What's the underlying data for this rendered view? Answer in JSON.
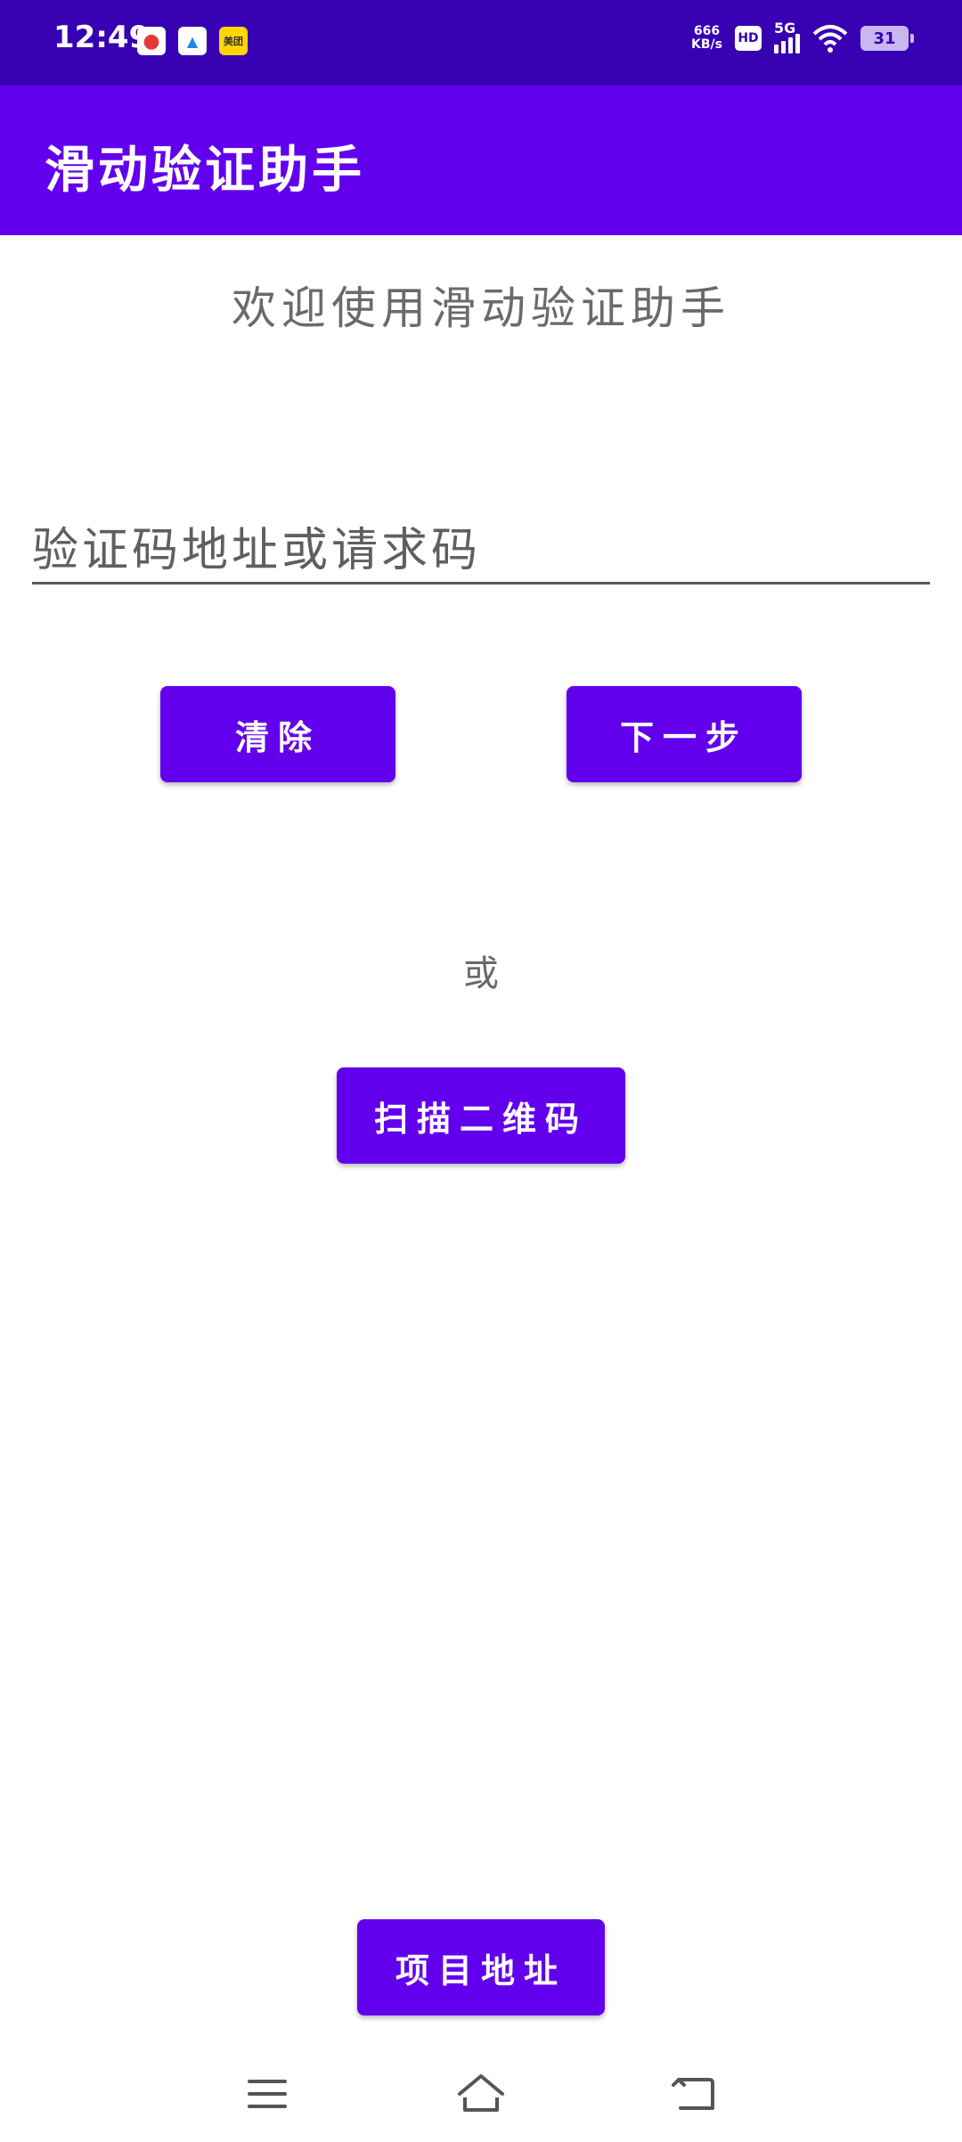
{
  "status_bar": {
    "time": "12:49",
    "notifications": [
      "map-pin-icon",
      "game-icon",
      "meituan-icon"
    ],
    "meituan_label": "美团",
    "speed_value": "666",
    "speed_unit": "KB/s",
    "hd_label": "HD",
    "network_label": "5G",
    "battery": "31"
  },
  "app_bar": {
    "title": "滑动验证助手"
  },
  "main": {
    "welcome": "欢迎使用滑动验证助手",
    "input_placeholder": "验证码地址或请求码",
    "clear_label": "清除",
    "next_label": "下一步",
    "or_label": "或",
    "scan_label": "扫描二维码",
    "project_label": "项目地址"
  },
  "nav_bar": {
    "icons": [
      "menu-icon",
      "home-icon",
      "back-icon"
    ]
  },
  "colors": {
    "primary": "#6200ee",
    "primary_dark": "#3700b3",
    "text_gray": "#6a6a6a"
  }
}
